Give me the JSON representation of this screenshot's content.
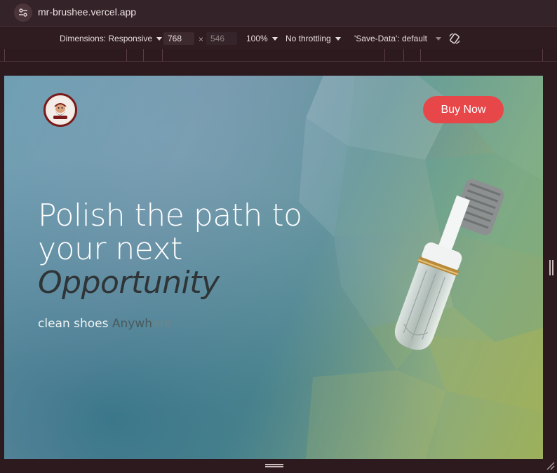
{
  "browser": {
    "url": "mr-brushee.vercel.app"
  },
  "devtools": {
    "dimensions_label": "Dimensions: Responsive",
    "width_value": "768",
    "times": "×",
    "height_value": "546",
    "zoom": "100%",
    "throttling": "No throttling",
    "save_data": "'Save-Data': default"
  },
  "page": {
    "buy_button": "Buy Now",
    "headline_line1": "Polish the path to",
    "headline_line2": "your next",
    "headline_emphasis": "Opportunity",
    "sub_prefix": "clean shoes",
    "sub_word_a": "Anywh",
    "sub_word_b": "ere"
  },
  "colors": {
    "accent_button": "#e8474a",
    "browser_chrome": "#35232a"
  }
}
